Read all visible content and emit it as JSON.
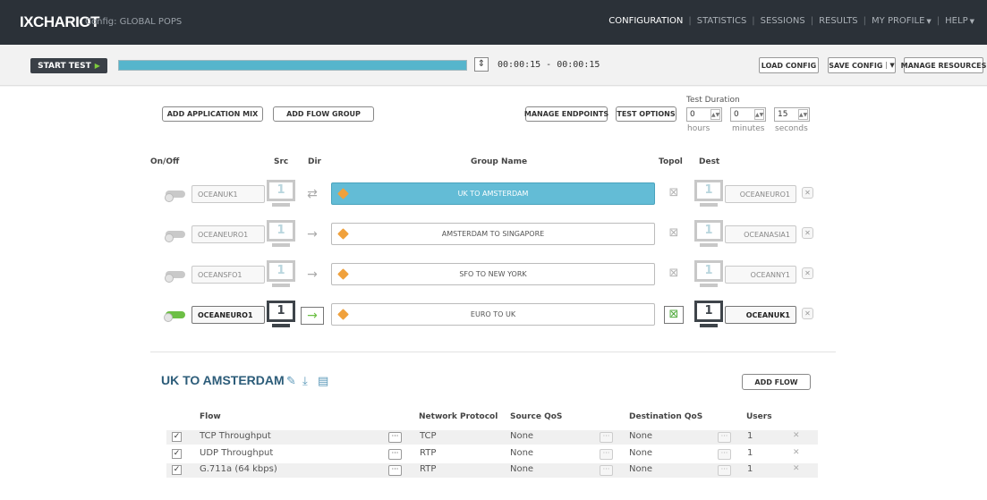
{
  "app": {
    "logo": "IXCHARIOT",
    "config_label": "Config: GLOBAL POPS"
  },
  "nav": {
    "items": [
      {
        "label": "CONFIGURATION",
        "active": true
      },
      {
        "label": "STATISTICS"
      },
      {
        "label": "SESSIONS"
      },
      {
        "label": "RESULTS"
      },
      {
        "label": "MY PROFILE",
        "caret": true
      },
      {
        "label": "HELP",
        "caret": true
      }
    ]
  },
  "toolbar": {
    "start_label": "START TEST",
    "progress_fraction": 1.0,
    "time_range": "00:00:15 - 00:00:15",
    "load_config": "LOAD CONFIG",
    "save_config": "SAVE CONFIG",
    "manage_resources": "MANAGE RESOURCES"
  },
  "actions": {
    "add_app_mix": "ADD APPLICATION MIX",
    "add_flow_group": "ADD FLOW GROUP",
    "manage_endpoints": "MANAGE ENDPOINTS",
    "test_options": "TEST OPTIONS"
  },
  "duration": {
    "title": "Test Duration",
    "hours": "0",
    "minutes": "0",
    "seconds": "15",
    "hours_label": "hours",
    "minutes_label": "minutes",
    "seconds_label": "seconds"
  },
  "columns": {
    "onoff": "On/Off",
    "src": "Src",
    "dir": "Dir",
    "group": "Group Name",
    "topol": "Topol",
    "dest": "Dest"
  },
  "groups": [
    {
      "src": "OCEANUK1",
      "src_count": "1",
      "dir": "⇄",
      "name": "UK TO AMSTERDAM",
      "dest": "OCEANEURO1",
      "dest_count": "1",
      "on": false,
      "selected": true
    },
    {
      "src": "OCEANEURO1",
      "src_count": "1",
      "dir": "→",
      "name": "AMSTERDAM TO SINGAPORE",
      "dest": "OCEANASIA1",
      "dest_count": "1",
      "on": false,
      "selected": false
    },
    {
      "src": "OCEANSFO1",
      "src_count": "1",
      "dir": "→",
      "name": "SFO TO NEW YORK",
      "dest": "OCEANNY1",
      "dest_count": "1",
      "on": false,
      "selected": false
    },
    {
      "src": "OCEANEURO1",
      "src_count": "1",
      "dir": "→",
      "name": "EURO TO UK",
      "dest": "OCEANUK1",
      "dest_count": "1",
      "on": true,
      "selected": false
    }
  ],
  "detail": {
    "title": "UK TO AMSTERDAM",
    "add_flow": "ADD FLOW",
    "headers": {
      "flow": "Flow",
      "protocol": "Network Protocol",
      "src_qos": "Source QoS",
      "dst_qos": "Destination QoS",
      "users": "Users"
    },
    "flows": [
      {
        "checked": "✓",
        "name": "TCP Throughput",
        "protocol": "TCP",
        "src_qos": "None",
        "dst_qos": "None",
        "users": "1"
      },
      {
        "checked": "✓",
        "name": "UDP Throughput",
        "protocol": "RTP",
        "src_qos": "None",
        "dst_qos": "None",
        "users": "1"
      },
      {
        "checked": "✓",
        "name": "G.711a (64 kbps)",
        "protocol": "RTP",
        "src_qos": "None",
        "dst_qos": "None",
        "users": "1"
      }
    ]
  }
}
